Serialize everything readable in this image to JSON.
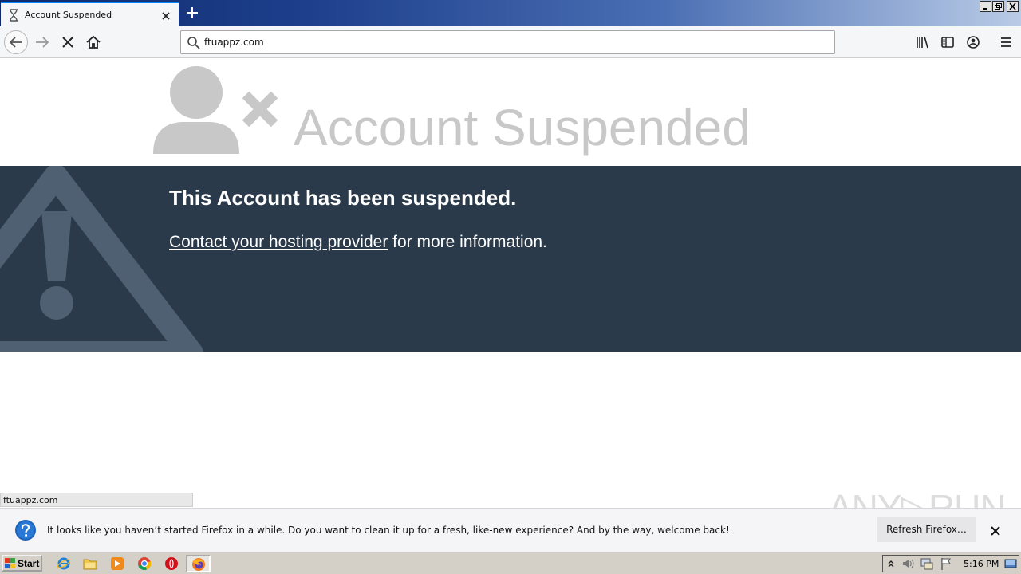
{
  "browser": {
    "tab": {
      "title": "Account Suspended"
    },
    "url": "ftuappz.com",
    "status_url": "ftuappz.com"
  },
  "page": {
    "headline": "Account Suspended",
    "banner_title": "This Account has been suspended.",
    "contact_link": "Contact your hosting provider",
    "contact_rest": " for more information."
  },
  "notification": {
    "message": "It looks like you haven’t started Firefox in a while. Do you want to clean it up for a fresh, like-new experience? And by the way, welcome back!",
    "button": "Refresh Firefox…"
  },
  "taskbar": {
    "start_label": "Start",
    "clock": "5:16 PM"
  },
  "watermark": "ANY▷RUN",
  "colors": {
    "banner_bg": "#2b3a4b",
    "headline_gray": "#c8c8c8",
    "tab_accent": "#0a84ff"
  }
}
